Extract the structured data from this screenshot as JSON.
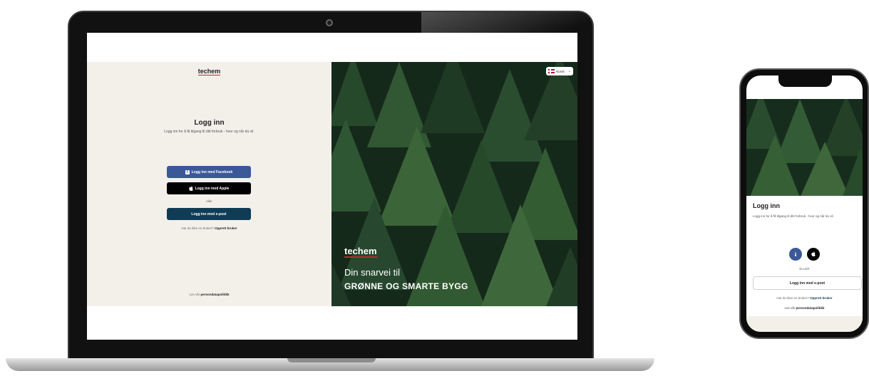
{
  "laptop": {
    "logo": "techem",
    "login": {
      "title": "Logg inn",
      "subtitle": "Logg inn for å få tilgang til ditt forbruk - hvor og når du vil.",
      "facebook_label": "Logg inn med Facebook",
      "apple_label": "Logg inn med Apple",
      "or_label": "eller",
      "email_label": "Logg inn med e-post",
      "signup_prompt": "Har du ikke en bruker?",
      "signup_link": "Opprett bruker",
      "privacy_prompt": "Les vår",
      "privacy_link": "persondatapolitikk"
    },
    "hero": {
      "language": "Norsk",
      "logo": "techem",
      "tagline_line1": "Din snarvei til",
      "tagline_line2": "GRØNNE OG SMARTE BYGG"
    }
  },
  "phone": {
    "title": "Logg inn",
    "subtitle": "Logg inn for å få tilgang til ditt forbruk - hvor og når du vil.",
    "or_label": "ELLER",
    "email_label": "Logg inn med e-post",
    "signup_prompt": "Har du ikke en bruker?",
    "signup_link": "Opprett bruker",
    "privacy_prompt": "Les vår",
    "privacy_link": "persondatapolitikk"
  },
  "colors": {
    "facebook": "#3b5998",
    "apple": "#000000",
    "email_button": "#0f3c55",
    "brand_red": "#c0292e",
    "panel_beige": "#f3f0ea",
    "forest_green": "#1e3a27"
  },
  "icons": [
    "facebook-icon",
    "apple-icon",
    "flag-norway-icon",
    "chevron-down-icon",
    "webcam"
  ]
}
